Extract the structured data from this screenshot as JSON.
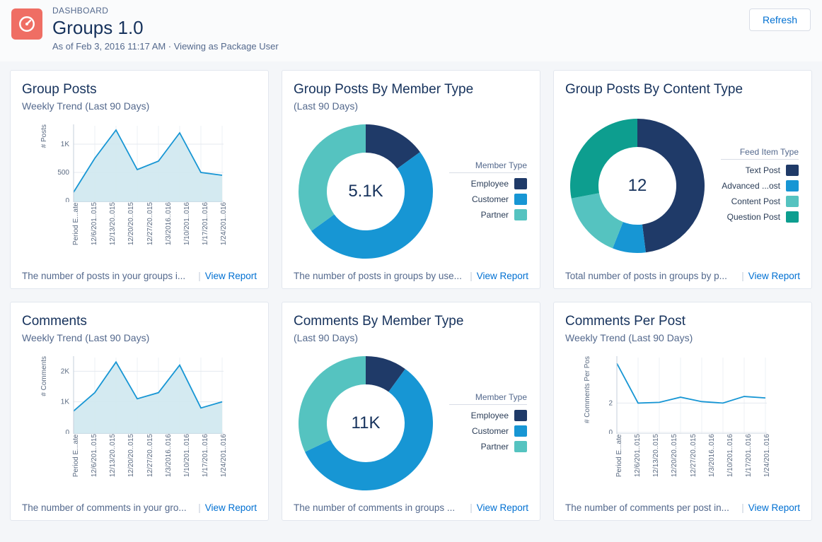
{
  "header": {
    "kicker": "DASHBOARD",
    "title": "Groups 1.0",
    "sub": "As of Feb 3, 2016 11:17 AM · Viewing as Package User",
    "refresh": "Refresh"
  },
  "palette": {
    "c1": "#1f3a68",
    "c2": "#1796d4",
    "c3": "#55c3c0",
    "c4": "#0d9e8f",
    "area": "#cfe8ef",
    "line": "#1796d4"
  },
  "cards": [
    {
      "id": "group-posts",
      "title": "Group Posts",
      "sub": "Weekly Trend (Last 90 Days)",
      "desc": "The number of posts in your groups i...",
      "link": "View Report",
      "chart_kind": "area",
      "yaxis": "# Posts",
      "xaxis_first": "Period E...ate"
    },
    {
      "id": "posts-member",
      "title": "Group Posts By Member Type",
      "sub": "(Last 90 Days)",
      "desc": "The number of posts in groups by use...",
      "link": "View Report",
      "chart_kind": "donut",
      "center": "5.1K",
      "legend_title": "Member Type",
      "legend": [
        "Employee",
        "Customer",
        "Partner"
      ]
    },
    {
      "id": "posts-content",
      "title": "Group Posts By Content Type",
      "sub": "",
      "desc": "Total number of posts in groups by p...",
      "link": "View Report",
      "chart_kind": "donut",
      "center": "12",
      "legend_title": "Feed Item Type",
      "legend": [
        "Text Post",
        "Advanced ...ost",
        "Content Post",
        "Question Post"
      ]
    },
    {
      "id": "comments",
      "title": "Comments",
      "sub": "Weekly Trend (Last 90 Days)",
      "desc": "The number of comments in your gro...",
      "link": "View Report",
      "chart_kind": "area",
      "yaxis": "# Comments",
      "xaxis_first": "Period E...ate"
    },
    {
      "id": "comments-member",
      "title": "Comments By Member Type",
      "sub": "(Last 90 Days)",
      "desc": "The number of comments in groups ...",
      "link": "View Report",
      "chart_kind": "donut",
      "center": "11K",
      "legend_title": "Member Type",
      "legend": [
        "Employee",
        "Customer",
        "Partner"
      ]
    },
    {
      "id": "comments-per-post",
      "title": "Comments Per Post",
      "sub": "Weekly Trend (Last 90 Days)",
      "desc": "The number of comments per post in...",
      "link": "View Report",
      "chart_kind": "line",
      "yaxis": "# Comments Per Pos",
      "xaxis_first": "Period E...ate"
    }
  ],
  "chart_data": [
    {
      "id": "group-posts",
      "type": "area",
      "categories": [
        "12/6/201..015",
        "12/13/20..015",
        "12/20/20..015",
        "12/27/20..015",
        "1/3/2016..016",
        "1/10/201..016",
        "1/17/201..016",
        "1/24/201..016"
      ],
      "values": [
        150,
        750,
        1250,
        550,
        700,
        1200,
        500,
        450
      ],
      "ylabel": "# Posts",
      "yticks": [
        0,
        500,
        1000
      ],
      "ylim": [
        0,
        1300
      ]
    },
    {
      "id": "posts-member",
      "type": "donut",
      "total": "5.1K",
      "series": [
        {
          "name": "Employee",
          "value": 15,
          "color": "#1f3a68"
        },
        {
          "name": "Customer",
          "value": 50,
          "color": "#1796d4"
        },
        {
          "name": "Partner",
          "value": 35,
          "color": "#55c3c0"
        }
      ],
      "legend_title": "Member Type"
    },
    {
      "id": "posts-content",
      "type": "donut",
      "total": "12",
      "series": [
        {
          "name": "Text Post",
          "value": 48,
          "color": "#1f3a68"
        },
        {
          "name": "Advanced ...ost",
          "value": 8,
          "color": "#1796d4"
        },
        {
          "name": "Content Post",
          "value": 16,
          "color": "#55c3c0"
        },
        {
          "name": "Question Post",
          "value": 28,
          "color": "#0d9e8f"
        }
      ],
      "legend_title": "Feed Item Type"
    },
    {
      "id": "comments",
      "type": "area",
      "categories": [
        "12/6/201..015",
        "12/13/20..015",
        "12/20/20..015",
        "12/27/20..015",
        "1/3/2016..016",
        "1/10/201..016",
        "1/17/201..016",
        "1/24/201..016"
      ],
      "values": [
        700,
        1300,
        2300,
        1100,
        1300,
        2200,
        800,
        1000
      ],
      "ylabel": "# Comments",
      "yticks": [
        0,
        1000,
        2000
      ],
      "ylim": [
        0,
        2400
      ]
    },
    {
      "id": "comments-member",
      "type": "donut",
      "total": "11K",
      "series": [
        {
          "name": "Employee",
          "value": 10,
          "color": "#1f3a68"
        },
        {
          "name": "Customer",
          "value": 58,
          "color": "#1796d4"
        },
        {
          "name": "Partner",
          "value": 32,
          "color": "#55c3c0"
        }
      ],
      "legend_title": "Member Type"
    },
    {
      "id": "comments-per-post",
      "type": "line",
      "categories": [
        "12/6/201..015",
        "12/13/20..015",
        "12/20/20..015",
        "12/27/20..015",
        "1/3/2016..016",
        "1/10/201..016",
        "1/17/201..016",
        "1/24/201..016"
      ],
      "values": [
        4.7,
        2.0,
        2.05,
        2.4,
        2.1,
        2.0,
        2.45,
        2.35
      ],
      "ylabel": "# Comments Per Pos",
      "yticks": [
        0,
        2
      ],
      "ylim": [
        0,
        5
      ]
    }
  ]
}
